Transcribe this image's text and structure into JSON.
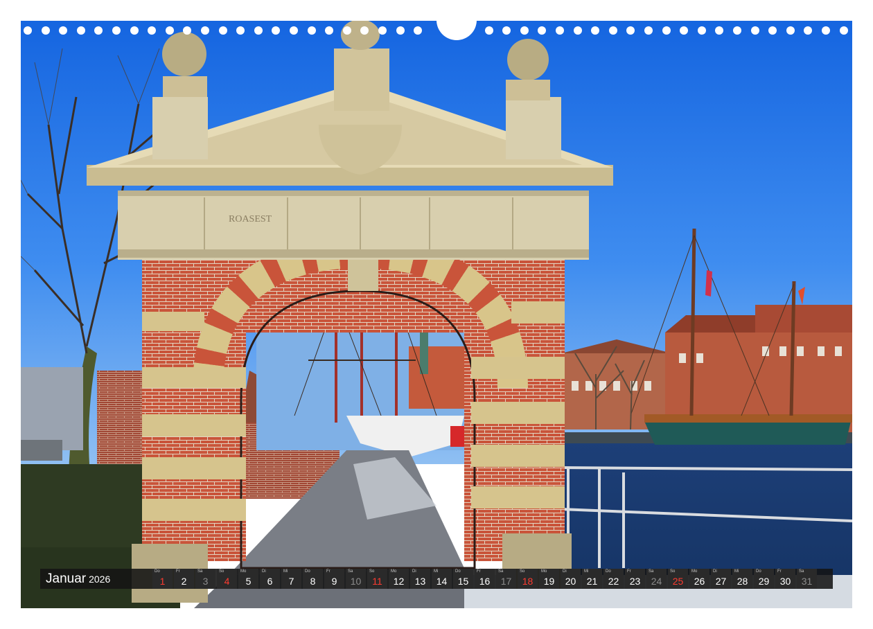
{
  "photo": {
    "engraved_text": "ROASEST"
  },
  "calendar": {
    "month": "Januar",
    "year": "2026",
    "colors": {
      "weekday": "#ffffff",
      "weekend": "#8c8c8c",
      "holiday": "#ff3b30"
    },
    "days": [
      {
        "wd": "Do",
        "d": "1",
        "type": "holiday"
      },
      {
        "wd": "Fr",
        "d": "2",
        "type": "weekday"
      },
      {
        "wd": "Sa",
        "d": "3",
        "type": "weekend"
      },
      {
        "wd": "So",
        "d": "4",
        "type": "holiday"
      },
      {
        "wd": "Mo",
        "d": "5",
        "type": "weekday"
      },
      {
        "wd": "Di",
        "d": "6",
        "type": "weekday"
      },
      {
        "wd": "Mi",
        "d": "7",
        "type": "weekday"
      },
      {
        "wd": "Do",
        "d": "8",
        "type": "weekday"
      },
      {
        "wd": "Fr",
        "d": "9",
        "type": "weekday"
      },
      {
        "wd": "Sa",
        "d": "10",
        "type": "weekend"
      },
      {
        "wd": "So",
        "d": "11",
        "type": "holiday"
      },
      {
        "wd": "Mo",
        "d": "12",
        "type": "weekday"
      },
      {
        "wd": "Di",
        "d": "13",
        "type": "weekday"
      },
      {
        "wd": "Mi",
        "d": "14",
        "type": "weekday"
      },
      {
        "wd": "Do",
        "d": "15",
        "type": "weekday"
      },
      {
        "wd": "Fr",
        "d": "16",
        "type": "weekday"
      },
      {
        "wd": "Sa",
        "d": "17",
        "type": "weekend"
      },
      {
        "wd": "So",
        "d": "18",
        "type": "holiday"
      },
      {
        "wd": "Mo",
        "d": "19",
        "type": "weekday"
      },
      {
        "wd": "Di",
        "d": "20",
        "type": "weekday"
      },
      {
        "wd": "Mi",
        "d": "21",
        "type": "weekday"
      },
      {
        "wd": "Do",
        "d": "22",
        "type": "weekday"
      },
      {
        "wd": "Fr",
        "d": "23",
        "type": "weekday"
      },
      {
        "wd": "Sa",
        "d": "24",
        "type": "weekend"
      },
      {
        "wd": "So",
        "d": "25",
        "type": "holiday"
      },
      {
        "wd": "Mo",
        "d": "26",
        "type": "weekday"
      },
      {
        "wd": "Di",
        "d": "27",
        "type": "weekday"
      },
      {
        "wd": "Mi",
        "d": "28",
        "type": "weekday"
      },
      {
        "wd": "Do",
        "d": "29",
        "type": "weekday"
      },
      {
        "wd": "Fr",
        "d": "30",
        "type": "weekday"
      },
      {
        "wd": "Sa",
        "d": "31",
        "type": "weekend"
      }
    ]
  }
}
